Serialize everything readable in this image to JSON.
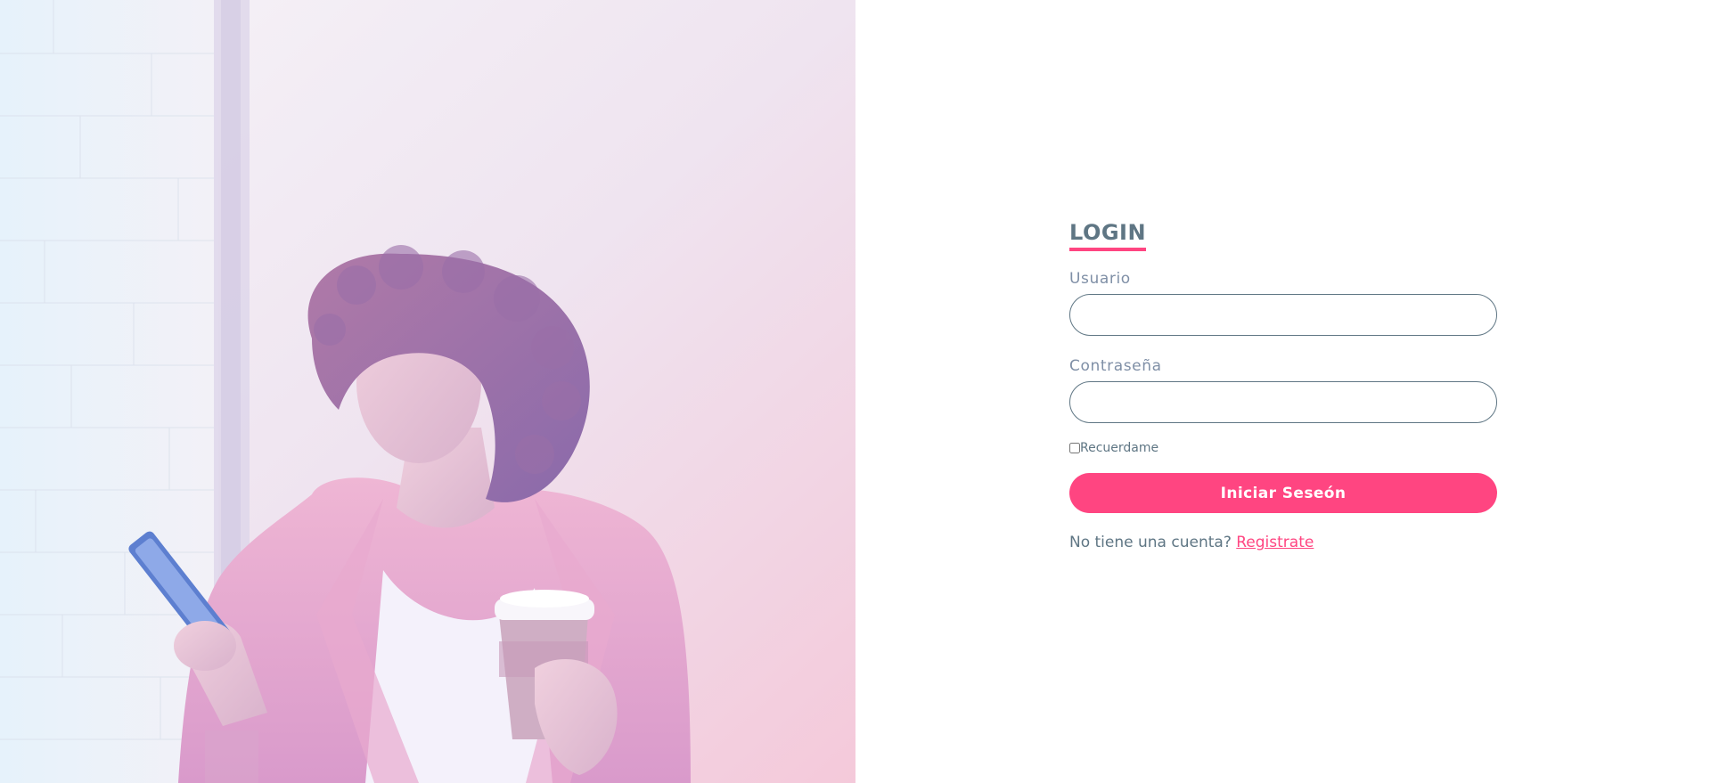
{
  "login": {
    "title": "LOGIN",
    "username_label": "Usuario",
    "username_value": "",
    "password_label": "Contraseña",
    "password_value": "",
    "remember_label": "Recuerdame",
    "remember_checked": false,
    "submit_label": "Iniciar Seseón",
    "signup_prompt": "No tiene una cuenta?",
    "signup_link": "Registrate"
  },
  "colors": {
    "accent": "#ff4581",
    "text": "#5f7684",
    "label": "#7f8fa6",
    "background": "#ffffff"
  },
  "hero": {
    "image": "woman-with-phone-and-coffee"
  }
}
